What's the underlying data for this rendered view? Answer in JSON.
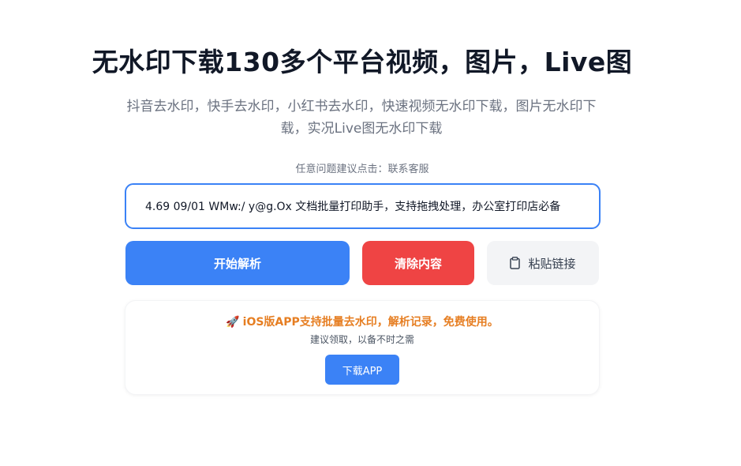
{
  "header": {
    "title": "无水印下载130多个平台视频，图片，Live图",
    "subtitle": "抖音去水印，快手去水印，小红书去水印，快速视频无水印下载，图片无水印下载，实况Live图无水印下载"
  },
  "contact": {
    "prefix": "任意问题建议点击：",
    "link_label": "联系客服"
  },
  "input": {
    "value": "4.69 09/01 WMw:/ y@g.Ox 文档批量打印助手，支持拖拽处理，办公室打印店必备"
  },
  "buttons": {
    "parse_label": "开始解析",
    "clear_label": "清除内容",
    "paste_label": "粘贴链接",
    "paste_icon": "clipboard-icon"
  },
  "promo": {
    "icon": "rocket-icon",
    "title": "iOS版APP支持批量去水印，解析记录，免费使用。",
    "subtitle": "建议领取，以备不时之需",
    "button_label": "下载APP"
  },
  "colors": {
    "primary": "#3b82f6",
    "danger": "#ef4444",
    "neutral": "#f3f4f6",
    "promo_text": "#e67e22"
  }
}
